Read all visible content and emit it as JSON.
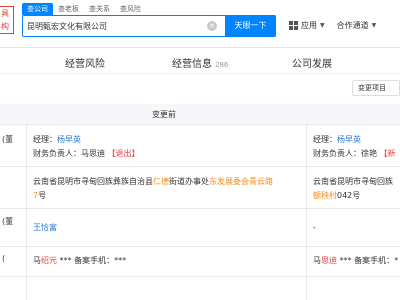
{
  "logo": {
    "text": "具构"
  },
  "search": {
    "tabs": [
      "查公司",
      "查老板",
      "查关系",
      "查风险"
    ],
    "active_tab": 0,
    "value": "昆明甄宏文化有限公司",
    "button": "天眼一下"
  },
  "top_nav": {
    "app_label": "应用",
    "partner_label": "合作通道"
  },
  "sections": [
    {
      "label": "经营风险",
      "count": ""
    },
    {
      "label": "经营信息",
      "count": "286"
    },
    {
      "label": "公司发展",
      "count": ""
    }
  ],
  "filter_button": "变更项目",
  "table": {
    "header_before": "变更前",
    "left_labels": [
      "(董",
      "(董",
      "("
    ],
    "rows": [
      {
        "before": {
          "line1_prefix": "经理：",
          "line1_name": "杨早英",
          "line2_prefix": "财务负责人：马思迪 ",
          "line2_tag": "【退出】"
        },
        "after": {
          "line1_prefix": "经理：",
          "line1_name": "杨早英",
          "line2_prefix": "财务负责人：徐艳 ",
          "line2_tag": "【新"
        }
      },
      {
        "before": {
          "part1": "云南省昆明市寻甸回族彝族自治县",
          "hl1": "仁德",
          "part2": "街道办事处",
          "hl2": "东发展委会青云路",
          "line2_hl": "7",
          "line2_rest": "号"
        },
        "after": {
          "line1": "云南省昆明市寻甸回族",
          "line2_hl": "额秧村",
          "line2_rest": "042号"
        }
      },
      {
        "before": {
          "name": "王恰富"
        },
        "after": {
          "name": "-"
        }
      },
      {
        "before": {
          "prefix": "马",
          "hl": "绍元",
          "rest": " *** 备案手机：***"
        },
        "after": {
          "prefix": "马",
          "hl": "思迪",
          "rest": " *** 备案手机：*"
        }
      }
    ]
  }
}
